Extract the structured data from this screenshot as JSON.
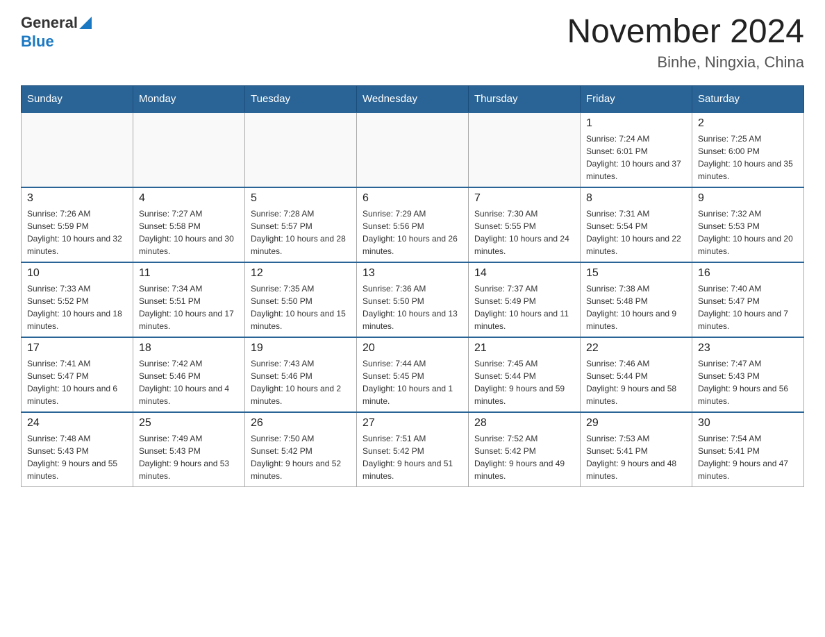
{
  "header": {
    "logo_general": "General",
    "logo_blue": "Blue",
    "month_year": "November 2024",
    "location": "Binhe, Ningxia, China"
  },
  "weekdays": [
    "Sunday",
    "Monday",
    "Tuesday",
    "Wednesday",
    "Thursday",
    "Friday",
    "Saturday"
  ],
  "weeks": [
    [
      {
        "day": "",
        "info": ""
      },
      {
        "day": "",
        "info": ""
      },
      {
        "day": "",
        "info": ""
      },
      {
        "day": "",
        "info": ""
      },
      {
        "day": "",
        "info": ""
      },
      {
        "day": "1",
        "info": "Sunrise: 7:24 AM\nSunset: 6:01 PM\nDaylight: 10 hours and 37 minutes."
      },
      {
        "day": "2",
        "info": "Sunrise: 7:25 AM\nSunset: 6:00 PM\nDaylight: 10 hours and 35 minutes."
      }
    ],
    [
      {
        "day": "3",
        "info": "Sunrise: 7:26 AM\nSunset: 5:59 PM\nDaylight: 10 hours and 32 minutes."
      },
      {
        "day": "4",
        "info": "Sunrise: 7:27 AM\nSunset: 5:58 PM\nDaylight: 10 hours and 30 minutes."
      },
      {
        "day": "5",
        "info": "Sunrise: 7:28 AM\nSunset: 5:57 PM\nDaylight: 10 hours and 28 minutes."
      },
      {
        "day": "6",
        "info": "Sunrise: 7:29 AM\nSunset: 5:56 PM\nDaylight: 10 hours and 26 minutes."
      },
      {
        "day": "7",
        "info": "Sunrise: 7:30 AM\nSunset: 5:55 PM\nDaylight: 10 hours and 24 minutes."
      },
      {
        "day": "8",
        "info": "Sunrise: 7:31 AM\nSunset: 5:54 PM\nDaylight: 10 hours and 22 minutes."
      },
      {
        "day": "9",
        "info": "Sunrise: 7:32 AM\nSunset: 5:53 PM\nDaylight: 10 hours and 20 minutes."
      }
    ],
    [
      {
        "day": "10",
        "info": "Sunrise: 7:33 AM\nSunset: 5:52 PM\nDaylight: 10 hours and 18 minutes."
      },
      {
        "day": "11",
        "info": "Sunrise: 7:34 AM\nSunset: 5:51 PM\nDaylight: 10 hours and 17 minutes."
      },
      {
        "day": "12",
        "info": "Sunrise: 7:35 AM\nSunset: 5:50 PM\nDaylight: 10 hours and 15 minutes."
      },
      {
        "day": "13",
        "info": "Sunrise: 7:36 AM\nSunset: 5:50 PM\nDaylight: 10 hours and 13 minutes."
      },
      {
        "day": "14",
        "info": "Sunrise: 7:37 AM\nSunset: 5:49 PM\nDaylight: 10 hours and 11 minutes."
      },
      {
        "day": "15",
        "info": "Sunrise: 7:38 AM\nSunset: 5:48 PM\nDaylight: 10 hours and 9 minutes."
      },
      {
        "day": "16",
        "info": "Sunrise: 7:40 AM\nSunset: 5:47 PM\nDaylight: 10 hours and 7 minutes."
      }
    ],
    [
      {
        "day": "17",
        "info": "Sunrise: 7:41 AM\nSunset: 5:47 PM\nDaylight: 10 hours and 6 minutes."
      },
      {
        "day": "18",
        "info": "Sunrise: 7:42 AM\nSunset: 5:46 PM\nDaylight: 10 hours and 4 minutes."
      },
      {
        "day": "19",
        "info": "Sunrise: 7:43 AM\nSunset: 5:46 PM\nDaylight: 10 hours and 2 minutes."
      },
      {
        "day": "20",
        "info": "Sunrise: 7:44 AM\nSunset: 5:45 PM\nDaylight: 10 hours and 1 minute."
      },
      {
        "day": "21",
        "info": "Sunrise: 7:45 AM\nSunset: 5:44 PM\nDaylight: 9 hours and 59 minutes."
      },
      {
        "day": "22",
        "info": "Sunrise: 7:46 AM\nSunset: 5:44 PM\nDaylight: 9 hours and 58 minutes."
      },
      {
        "day": "23",
        "info": "Sunrise: 7:47 AM\nSunset: 5:43 PM\nDaylight: 9 hours and 56 minutes."
      }
    ],
    [
      {
        "day": "24",
        "info": "Sunrise: 7:48 AM\nSunset: 5:43 PM\nDaylight: 9 hours and 55 minutes."
      },
      {
        "day": "25",
        "info": "Sunrise: 7:49 AM\nSunset: 5:43 PM\nDaylight: 9 hours and 53 minutes."
      },
      {
        "day": "26",
        "info": "Sunrise: 7:50 AM\nSunset: 5:42 PM\nDaylight: 9 hours and 52 minutes."
      },
      {
        "day": "27",
        "info": "Sunrise: 7:51 AM\nSunset: 5:42 PM\nDaylight: 9 hours and 51 minutes."
      },
      {
        "day": "28",
        "info": "Sunrise: 7:52 AM\nSunset: 5:42 PM\nDaylight: 9 hours and 49 minutes."
      },
      {
        "day": "29",
        "info": "Sunrise: 7:53 AM\nSunset: 5:41 PM\nDaylight: 9 hours and 48 minutes."
      },
      {
        "day": "30",
        "info": "Sunrise: 7:54 AM\nSunset: 5:41 PM\nDaylight: 9 hours and 47 minutes."
      }
    ]
  ]
}
